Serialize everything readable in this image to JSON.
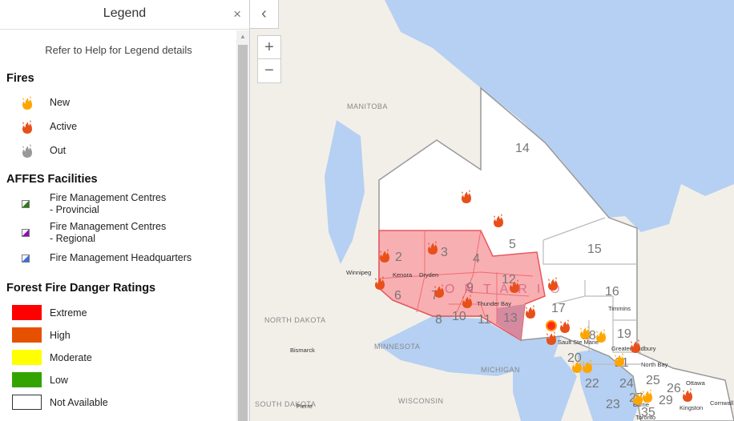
{
  "legend": {
    "title": "Legend",
    "close_icon": "×",
    "help_text": "Refer to Help for Legend details",
    "fires": {
      "heading": "Fires",
      "items": [
        {
          "label": "New",
          "icon": "fire-icon",
          "color": "#ffa500"
        },
        {
          "label": "Active",
          "icon": "fire-icon",
          "color": "#e8501a"
        },
        {
          "label": "Out",
          "icon": "fire-icon",
          "color": "#999999"
        }
      ]
    },
    "facilities": {
      "heading": "AFFES Facilities",
      "items": [
        {
          "line1": "Fire Management Centres",
          "line2": "- Provincial",
          "color": "#2e7d12"
        },
        {
          "line1": "Fire Management Centres",
          "line2": "- Regional",
          "color": "#8a0fb5"
        },
        {
          "line1": "Fire Management Headquarters",
          "line2": "",
          "color": "#3b6ee8"
        }
      ]
    },
    "ratings": {
      "heading": "Forest Fire Danger Ratings",
      "items": [
        {
          "label": "Extreme",
          "color": "#ff0000"
        },
        {
          "label": "High",
          "color": "#e65100"
        },
        {
          "label": "Moderate",
          "color": "#ffff00"
        },
        {
          "label": "Low",
          "color": "#33a300"
        },
        {
          "label": "Not Available",
          "color": "#ffffff"
        }
      ]
    }
  },
  "map": {
    "collapse_icon": "‹",
    "zoom_in": "+",
    "zoom_out": "−",
    "regions": [
      "MANITOBA",
      "NORTH DAKOTA",
      "MINNESOTA",
      "MICHIGAN",
      "WISCONSIN",
      "SOUTH DAKOTA",
      "ONTARIO"
    ],
    "cities": [
      "Winnipeg",
      "Kenora",
      "Dryden",
      "Thunder Bay",
      "Timmins",
      "Sault Ste Marie",
      "Greater Sudbury",
      "North Bay",
      "Ottawa",
      "Kingston",
      "Cornwall",
      "Bismarck",
      "Pierre",
      "Toronto",
      "Barrie"
    ],
    "zones": [
      "2",
      "3",
      "4",
      "5",
      "6",
      "7",
      "8",
      "9",
      "10",
      "11",
      "12",
      "13",
      "14",
      "15",
      "16",
      "17",
      "18",
      "19",
      "20",
      "21",
      "22",
      "23",
      "24",
      "25",
      "26",
      "27",
      "29",
      "35"
    ]
  }
}
